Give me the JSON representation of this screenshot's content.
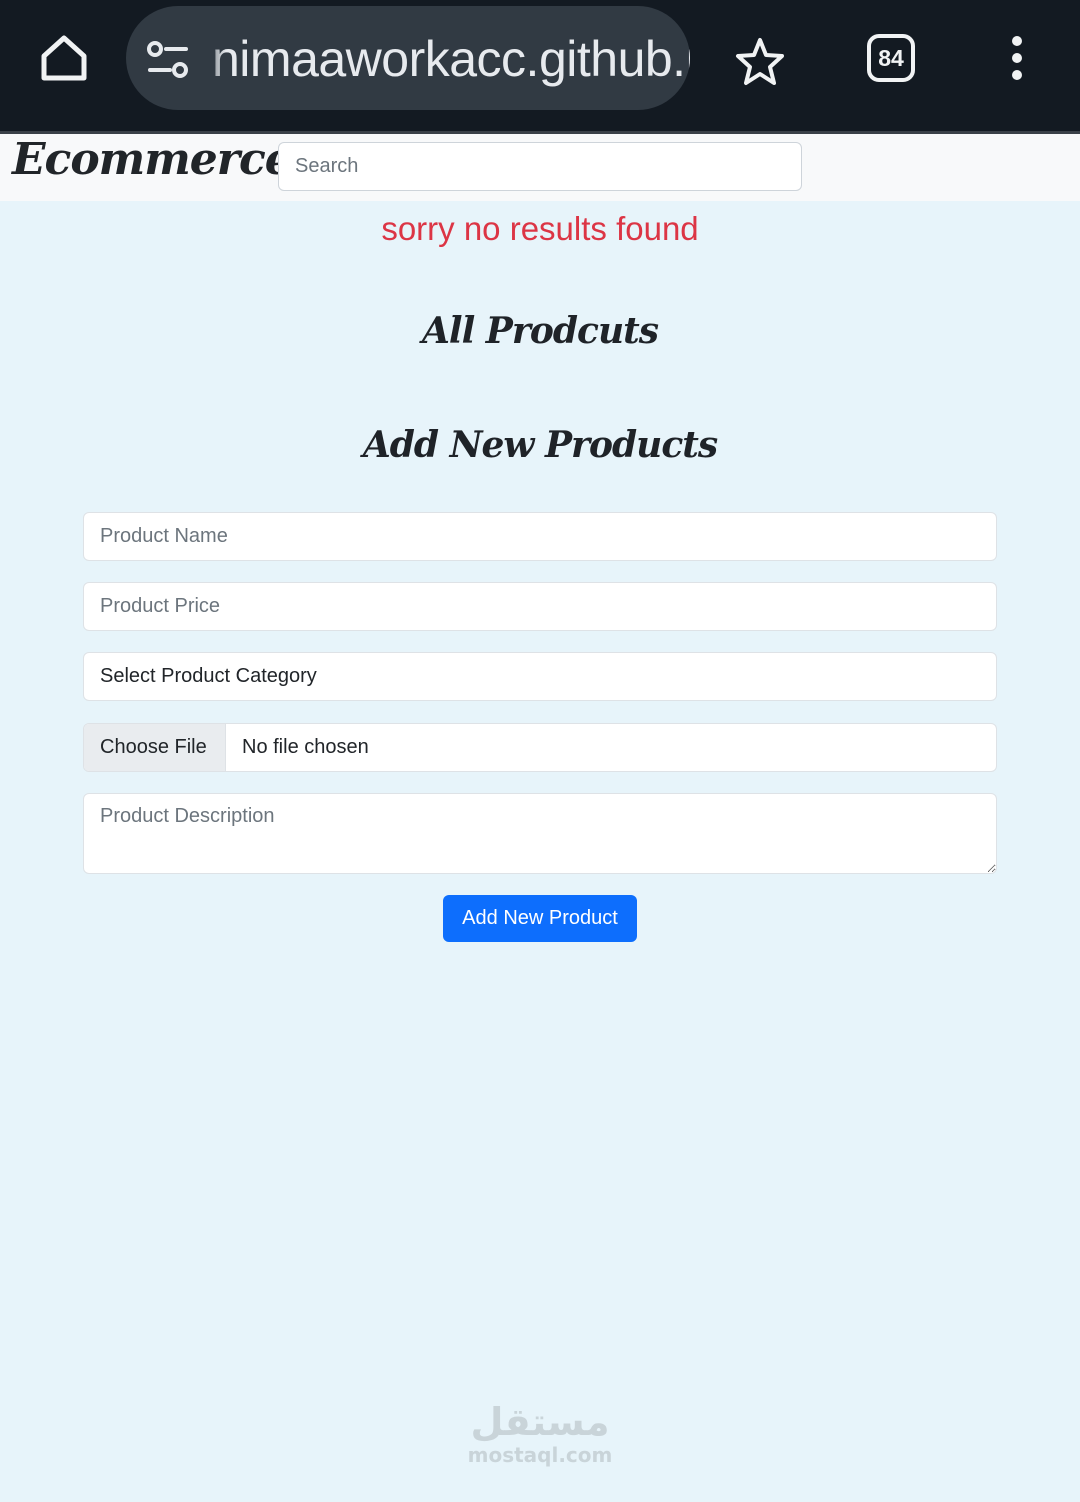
{
  "browser": {
    "url": "nimaaworkacc.github.io",
    "tab_count": "84"
  },
  "navbar": {
    "brand": "Ecommerce",
    "search_placeholder": "Search"
  },
  "main": {
    "no_results": "sorry no results found",
    "all_products_heading": "All Prodcuts",
    "add_products_heading": "Add New Products"
  },
  "form": {
    "name_placeholder": "Product Name",
    "price_placeholder": "Product Price",
    "category_selected": "Select Product Category",
    "file_button": "Choose File",
    "file_status": "No file chosen",
    "description_placeholder": "Product Description",
    "submit_label": "Add New Product"
  },
  "watermark": {
    "arabic": "مستقل",
    "domain": "mostaql.com"
  },
  "colors": {
    "chrome_bg": "#131a22",
    "page_bg": "#e7f4fa",
    "error_text": "#dc3545",
    "primary": "#0d6efd"
  },
  "icons": [
    "home-icon",
    "site-settings-icon",
    "bookmark-star-icon",
    "tabs-counter-icon",
    "more-menu-icon"
  ]
}
